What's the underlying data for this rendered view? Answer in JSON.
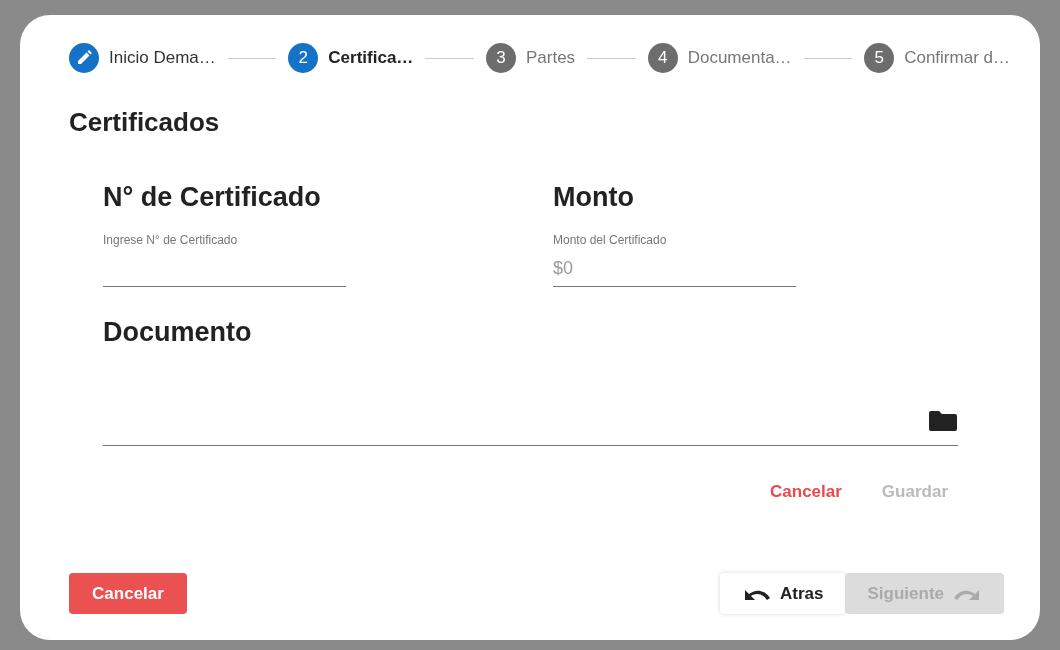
{
  "stepper": [
    {
      "label": "Inicio Dema…",
      "completed": true,
      "selected": false
    },
    {
      "number": "2",
      "label": "Certifica…",
      "completed": false,
      "selected": true
    },
    {
      "number": "3",
      "label": "Partes",
      "completed": false,
      "selected": false
    },
    {
      "number": "4",
      "label": "Documenta…",
      "completed": false,
      "selected": false
    },
    {
      "number": "5",
      "label": "Confirmar d…",
      "completed": false,
      "selected": false
    }
  ],
  "title": "Certificados",
  "fields": [
    {
      "heading": "N° de Certificado",
      "label": "Ingrese N° de Certificado"
    },
    {
      "heading": "Monto",
      "label": "Monto del Certificado",
      "placeholder": "$0"
    }
  ],
  "document": {
    "heading": "Documento"
  },
  "form_actions": [
    {
      "label": "Cancelar",
      "kind": "danger",
      "disabled": false
    },
    {
      "label": "Guardar",
      "kind": "primary",
      "disabled": true
    }
  ],
  "footer": {
    "cancel": {
      "label": "Cancelar"
    },
    "back": {
      "label": "Atras",
      "disabled": false
    },
    "next": {
      "label": "Siguiente",
      "disabled": true
    }
  }
}
